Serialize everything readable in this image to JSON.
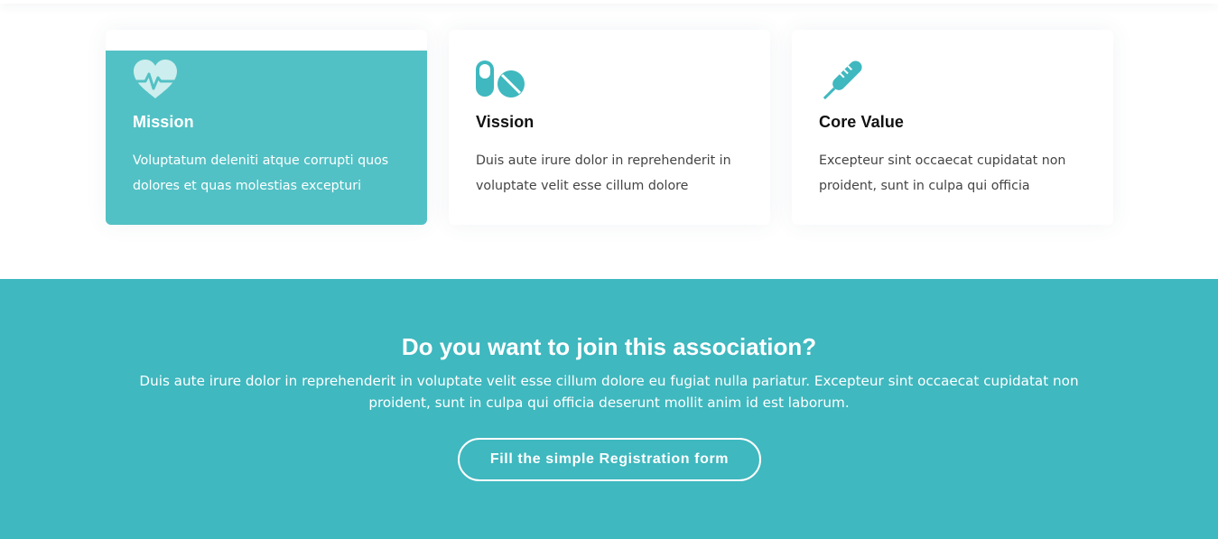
{
  "colors": {
    "accent": "#3fb8bf",
    "active_card": "#52c1c5",
    "icon": "#3fb8bf",
    "text_dark": "#111111",
    "text_body": "#444444"
  },
  "cards": [
    {
      "icon": "heartbeat-icon",
      "title": "Mission",
      "description": "Voluptatum deleniti atque corrupti quos dolores et quas molestias excepturi",
      "active": true
    },
    {
      "icon": "pills-icon",
      "title": "Vission",
      "description": "Duis aute irure dolor in reprehenderit in voluptate velit esse cillum dolore",
      "active": false
    },
    {
      "icon": "thermometer-icon",
      "title": "Core Value",
      "description": "Excepteur sint occaecat cupidatat non proident, sunt in culpa qui officia",
      "active": false
    }
  ],
  "cta": {
    "heading": "Do you want to join this association?",
    "paragraph": "Duis aute irure dolor in reprehenderit in voluptate velit esse cillum dolore eu fugiat nulla pariatur. Excepteur sint occaecat cupidatat non proident, sunt in culpa qui officia deserunt mollit anim id est laborum.",
    "button_label": "Fill the simple Registration form"
  }
}
